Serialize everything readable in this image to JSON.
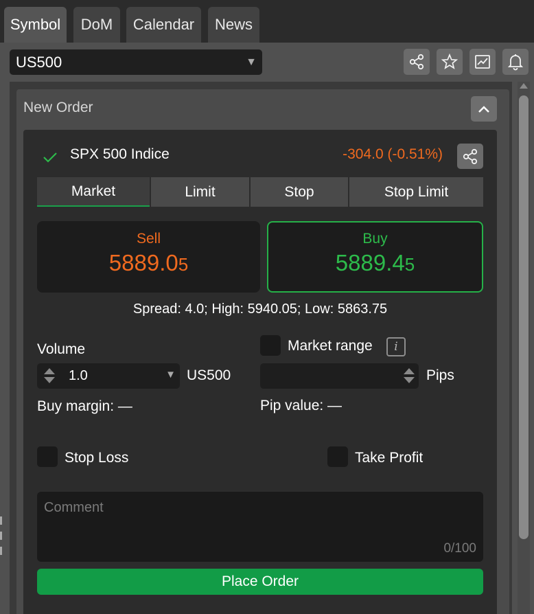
{
  "tabs": [
    "Symbol",
    "DoM",
    "Calendar",
    "News"
  ],
  "symbol_select": {
    "value": "US500"
  },
  "toolbar_icons": [
    "share-icon",
    "star-icon",
    "chart-icon",
    "bell-icon"
  ],
  "panel": {
    "title": "New Order"
  },
  "instrument": {
    "name": "SPX 500 Indice",
    "change": "-304.0 (-0.51%)"
  },
  "order_types": [
    "Market",
    "Limit",
    "Stop",
    "Stop Limit"
  ],
  "prices": {
    "sell": {
      "label": "Sell",
      "main": "5889.0",
      "last": "5"
    },
    "buy": {
      "label": "Buy",
      "main": "5889.4",
      "last": "5"
    }
  },
  "spread_text": "Spread: 4.0; High: 5940.05; Low: 5863.75",
  "volume": {
    "label": "Volume",
    "value": "1.0",
    "unit": "US500",
    "margin": "Buy margin: —"
  },
  "market_range": {
    "label": "Market range",
    "unit": "Pips",
    "pip_value": "Pip value: —"
  },
  "stop_loss": {
    "label": "Stop Loss"
  },
  "take_profit": {
    "label": "Take Profit"
  },
  "comment": {
    "placeholder": "Comment",
    "counter": "0/100"
  },
  "place_order": {
    "label": "Place Order"
  },
  "colors": {
    "sell": "#f06a1f",
    "buy": "#2dbb4b",
    "accent": "#129c47"
  }
}
